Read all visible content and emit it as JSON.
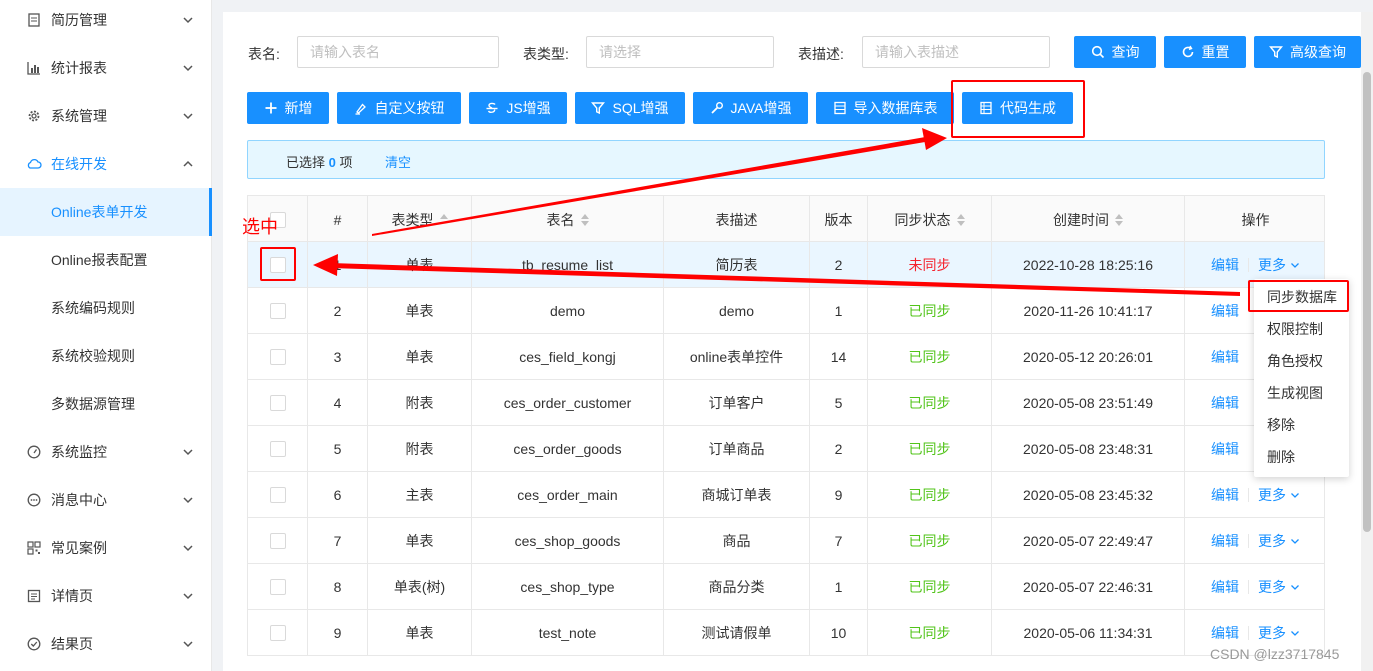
{
  "sidebar": {
    "items": [
      {
        "label": "简历管理",
        "icon": "resume-icon"
      },
      {
        "label": "统计报表",
        "icon": "bar-chart-icon"
      },
      {
        "label": "系统管理",
        "icon": "gear-icon"
      },
      {
        "label": "在线开发",
        "icon": "cloud-icon"
      },
      {
        "label": "Online表单开发"
      },
      {
        "label": "Online报表配置"
      },
      {
        "label": "系统编码规则"
      },
      {
        "label": "系统校验规则"
      },
      {
        "label": "多数据源管理"
      },
      {
        "label": "系统监控",
        "icon": "dashboard-icon"
      },
      {
        "label": "消息中心",
        "icon": "message-icon"
      },
      {
        "label": "常见案例",
        "icon": "qrcode-icon"
      },
      {
        "label": "详情页",
        "icon": "profile-icon"
      },
      {
        "label": "结果页",
        "icon": "check-circle-icon"
      }
    ]
  },
  "search": {
    "table_name_label": "表名:",
    "table_name_placeholder": "请输入表名",
    "table_type_label": "表类型:",
    "table_type_placeholder": "请选择",
    "table_desc_label": "表描述:",
    "table_desc_placeholder": "请输入表描述",
    "query": "查询",
    "reset": "重置",
    "advanced": "高级查询"
  },
  "toolbar": {
    "add": "新增",
    "custom_button": "自定义按钮",
    "js": "JS增强",
    "sql": "SQL增强",
    "java": "JAVA增强",
    "import": "导入数据库表",
    "codegen": "代码生成"
  },
  "alert": {
    "selected_prefix": "已选择",
    "selected_count": "0",
    "selected_suffix": "项",
    "clear": "清空"
  },
  "table": {
    "headers": [
      "#",
      "表类型",
      "表名",
      "表描述",
      "版本",
      "同步状态",
      "创建时间",
      "操作"
    ],
    "rows": [
      {
        "no": "1",
        "type": "单表",
        "name": "tb_resume_list",
        "desc": "简历表",
        "version": "2",
        "status": "未同步",
        "created": "2022-10-28 18:25:16"
      },
      {
        "no": "2",
        "type": "单表",
        "name": "demo",
        "desc": "demo",
        "version": "1",
        "status": "已同步",
        "created": "2020-11-26 10:41:17"
      },
      {
        "no": "3",
        "type": "单表",
        "name": "ces_field_kongj",
        "desc": "online表单控件",
        "version": "14",
        "status": "已同步",
        "created": "2020-05-12 20:26:01"
      },
      {
        "no": "4",
        "type": "附表",
        "name": "ces_order_customer",
        "desc": "订单客户",
        "version": "5",
        "status": "已同步",
        "created": "2020-05-08 23:51:49"
      },
      {
        "no": "5",
        "type": "附表",
        "name": "ces_order_goods",
        "desc": "订单商品",
        "version": "2",
        "status": "已同步",
        "created": "2020-05-08 23:48:31"
      },
      {
        "no": "6",
        "type": "主表",
        "name": "ces_order_main",
        "desc": "商城订单表",
        "version": "9",
        "status": "已同步",
        "created": "2020-05-08 23:45:32"
      },
      {
        "no": "7",
        "type": "单表",
        "name": "ces_shop_goods",
        "desc": "商品",
        "version": "7",
        "status": "已同步",
        "created": "2020-05-07 22:49:47"
      },
      {
        "no": "8",
        "type": "单表(树)",
        "name": "ces_shop_type",
        "desc": "商品分类",
        "version": "1",
        "status": "已同步",
        "created": "2020-05-07 22:46:31"
      },
      {
        "no": "9",
        "type": "单表",
        "name": "test_note",
        "desc": "测试请假单",
        "version": "10",
        "status": "已同步",
        "created": "2020-05-06 11:34:31"
      }
    ],
    "edit": "编辑",
    "more": "更多"
  },
  "dropdown": {
    "items": [
      "同步数据库",
      "权限控制",
      "角色授权",
      "生成视图",
      "移除",
      "删除"
    ]
  },
  "annotation": {
    "note": "选中",
    "color": "#ff0000"
  },
  "watermark": "CSDN @lzz3717845",
  "colors": {
    "primary": "#1890ff",
    "synced": "#52c41a",
    "unsynced": "#f5222d"
  }
}
